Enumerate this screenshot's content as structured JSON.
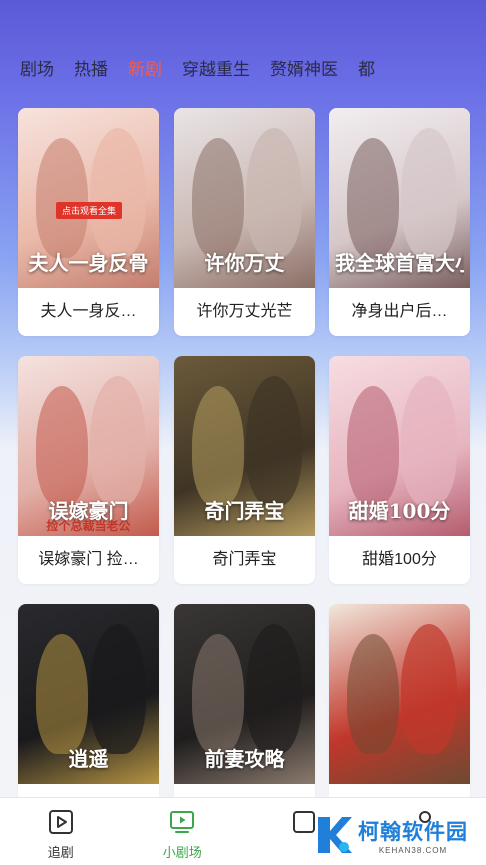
{
  "tabs": [
    {
      "label": "剧场",
      "active": false
    },
    {
      "label": "热播",
      "active": false
    },
    {
      "label": "新剧",
      "active": true
    },
    {
      "label": "穿越重生",
      "active": false
    },
    {
      "label": "赘婿神医",
      "active": false
    },
    {
      "label": "都",
      "active": false
    }
  ],
  "colors": {
    "active_tab": "#ff5a3c",
    "nav_active": "#3aa84a",
    "header_gradient_top": "#5b5ad6",
    "watermark_blue": "#1f7fd9"
  },
  "dramas": [
    {
      "title": "夫人一身反…",
      "poster_text": "夫人一身反骨",
      "poster_badge": "点击观看全集",
      "palette": [
        "#f7e3dd",
        "#e9b8a8",
        "#c47d6d"
      ]
    },
    {
      "title": "许你万丈光芒",
      "poster_text": "许你万丈",
      "palette": [
        "#e9e4e6",
        "#c9b7b1",
        "#8b6f66"
      ]
    },
    {
      "title": "净身出户后…",
      "poster_text": "我全球首富大小姐",
      "palette": [
        "#f2eef0",
        "#d6c7c9",
        "#7a5e5c"
      ]
    },
    {
      "title": "误嫁豪门 捡…",
      "poster_text": "误嫁豪门",
      "poster_sub": "捡个总裁当老公",
      "palette": [
        "#f4e2df",
        "#e2b0a8",
        "#c25a4c"
      ]
    },
    {
      "title": "奇门弄宝",
      "poster_text": "奇门弄宝",
      "palette": [
        "#6b5a3a",
        "#3f3425",
        "#b59c5f"
      ]
    },
    {
      "title": "甜婚100分",
      "poster_text": "甜婚100分",
      "palette": [
        "#f7dde2",
        "#e6b4bf",
        "#b45c6e"
      ]
    },
    {
      "title": "",
      "poster_text": "逍遥",
      "palette": [
        "#2a2a2e",
        "#1a1a1d",
        "#b59342"
      ]
    },
    {
      "title": "",
      "poster_text": "前妻攻略",
      "palette": [
        "#3a3636",
        "#1f1d1d",
        "#8a7a6e"
      ]
    },
    {
      "title": "",
      "poster_text": "",
      "palette": [
        "#f1e7dc",
        "#c1372b",
        "#6e4a32"
      ]
    }
  ],
  "bottom_nav": [
    {
      "label": "追剧",
      "icon": "play-square-icon",
      "active": false
    },
    {
      "label": "小剧场",
      "icon": "tv-play-icon",
      "active": true
    },
    {
      "label": "",
      "icon": "grid-icon",
      "active": false
    },
    {
      "label": "",
      "icon": "user-icon",
      "active": false
    }
  ],
  "watermark": {
    "main": "柯翰软件园",
    "sub": "KEHAN38.COM",
    "logo_icon": "k-logo-icon"
  }
}
